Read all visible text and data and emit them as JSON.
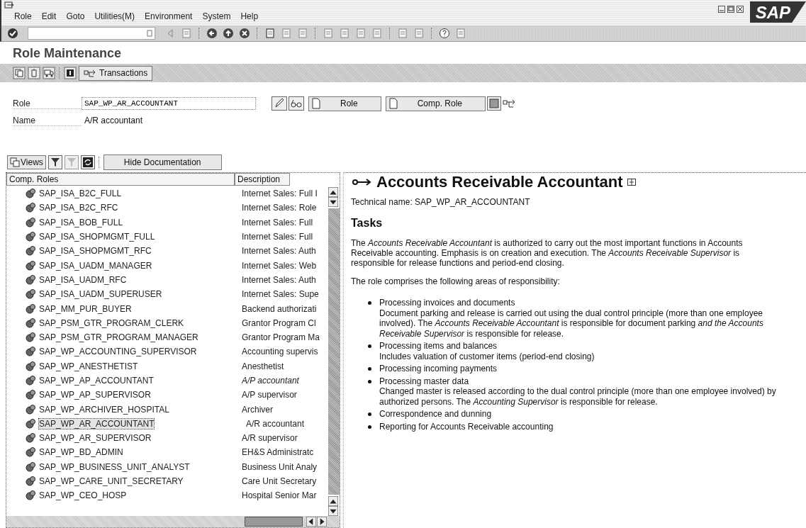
{
  "menu_bar": {
    "items": [
      "Role",
      "Edit",
      "Goto",
      "Utilities(M)",
      "Environment",
      "System",
      "Help"
    ],
    "logo": "SAP"
  },
  "title": "Role Maintenance",
  "app_toolbar": {
    "transactions_button": "Transactions"
  },
  "fields": [
    {
      "label": "Role",
      "value": "SAP_WP_AR_ACCOUNTANT",
      "kind": "input"
    },
    {
      "label": "Name",
      "value": "A/R accountant",
      "kind": "text"
    }
  ],
  "role_buttons": [
    "Role",
    "Comp. Role"
  ],
  "tree_toolbar": {
    "views_button": "Views",
    "documentation_button": "Hide Documentation"
  },
  "table": {
    "columns": [
      "Comp. Roles",
      "Description"
    ],
    "rows": [
      {
        "name": "SAP_ISA_B2C_FULL",
        "description": "Internet Sales: Full I",
        "italic": false,
        "selected": false
      },
      {
        "name": "SAP_ISA_B2C_RFC",
        "description": "Internet Sales: Role",
        "italic": false,
        "selected": false
      },
      {
        "name": "SAP_ISA_BOB_FULL",
        "description": "Internet Sales: Full",
        "italic": false,
        "selected": false
      },
      {
        "name": "SAP_ISA_SHOPMGMT_FULL",
        "description": "Internet Sales: Full",
        "italic": false,
        "selected": false
      },
      {
        "name": "SAP_ISA_SHOPMGMT_RFC",
        "description": "Internet Sales: Auth",
        "italic": false,
        "selected": false
      },
      {
        "name": "SAP_ISA_UADM_MANAGER",
        "description": "Internet Sales: Web",
        "italic": false,
        "selected": false
      },
      {
        "name": "SAP_ISA_UADM_RFC",
        "description": "Internet Sales: Auth",
        "italic": false,
        "selected": false
      },
      {
        "name": "SAP_ISA_UADM_SUPERUSER",
        "description": "Internet Sales: Supe",
        "italic": false,
        "selected": false
      },
      {
        "name": "SAP_MM_PUR_BUYER",
        "description": "Backend authorizati",
        "italic": false,
        "selected": false
      },
      {
        "name": "SAP_PSM_GTR_PROGRAM_CLERK",
        "description": "Grantor Program Cl",
        "italic": false,
        "selected": false
      },
      {
        "name": "SAP_PSM_GTR_PROGRAM_MANAGER",
        "description": "Grantor Program Ma",
        "italic": false,
        "selected": false
      },
      {
        "name": "SAP_WP_ACCOUNTING_SUPERVISOR",
        "description": "Accounting supervis",
        "italic": false,
        "selected": false
      },
      {
        "name": "SAP_WP_ANESTHETIST",
        "description": "Anesthetist",
        "italic": false,
        "selected": false
      },
      {
        "name": "SAP_WP_AP_ACCOUNTANT",
        "description": "A/P accountant",
        "italic": true,
        "selected": false
      },
      {
        "name": "SAP_WP_AP_SUPERVISOR",
        "description": "A/P supervisor",
        "italic": false,
        "selected": false
      },
      {
        "name": "SAP_WP_ARCHIVER_HOSPITAL",
        "description": "Archiver",
        "italic": false,
        "selected": false
      },
      {
        "name": "SAP_WP_AR_ACCOUNTANT",
        "description": "A/R accountant",
        "italic": false,
        "selected": true
      },
      {
        "name": "SAP_WP_AR_SUPERVISOR",
        "description": "A/R supervisor",
        "italic": false,
        "selected": false
      },
      {
        "name": "SAP_WP_BD_ADMIN",
        "description": "EH&S Administratc",
        "italic": false,
        "selected": false
      },
      {
        "name": "SAP_WP_BUSINESS_UNIT_ANALYST",
        "description": "Business Unit Analy",
        "italic": false,
        "selected": false
      },
      {
        "name": "SAP_WP_CARE_UNIT_SECRETARY",
        "description": "Care Unit Secretary",
        "italic": false,
        "selected": false
      },
      {
        "name": "SAP_WP_CEO_HOSP",
        "description": "Hospital Senior Mar",
        "italic": false,
        "selected": false
      }
    ]
  },
  "documentation": {
    "heading": "Accounts Receivable Accountant",
    "technical_name": "Technical name: SAP_WP_AR_ACCOUNTANT",
    "section": "Tasks",
    "paragraphs": [
      "The *Accounts Receivable Accountant* is authorized to carry out the most important functions in Accounts Receivable accounting. Emphasis is on creation and execution. The *Accounts Receivable Supervisor* is responsible for release functions and period-end closing.",
      "The role comprises the following areas of responsibility:"
    ],
    "bullets": [
      {
        "title": "Processing invoices and documents",
        "detail": "Document parking and release is carried out using the dual control principle (more than one employee involved). The *Accounts Receivable Accountant* is responsible for document parking *and the Accounts Receivable Supervisor* is responsible for release."
      },
      {
        "title": "Processing items and balances",
        "detail": "Includes valuation of customer items (period-end closing)"
      },
      {
        "title": "Processing incoming payments"
      },
      {
        "title": "Processing master data",
        "detail": "Changed master is released according to the dual control principle (more than one employee involved) by authorized persons. The *Accounting Supervisor* is responsible for release."
      },
      {
        "title": "Correspondence and dunning"
      },
      {
        "title": "Reporting for Accounts Receivable accounting"
      }
    ]
  }
}
